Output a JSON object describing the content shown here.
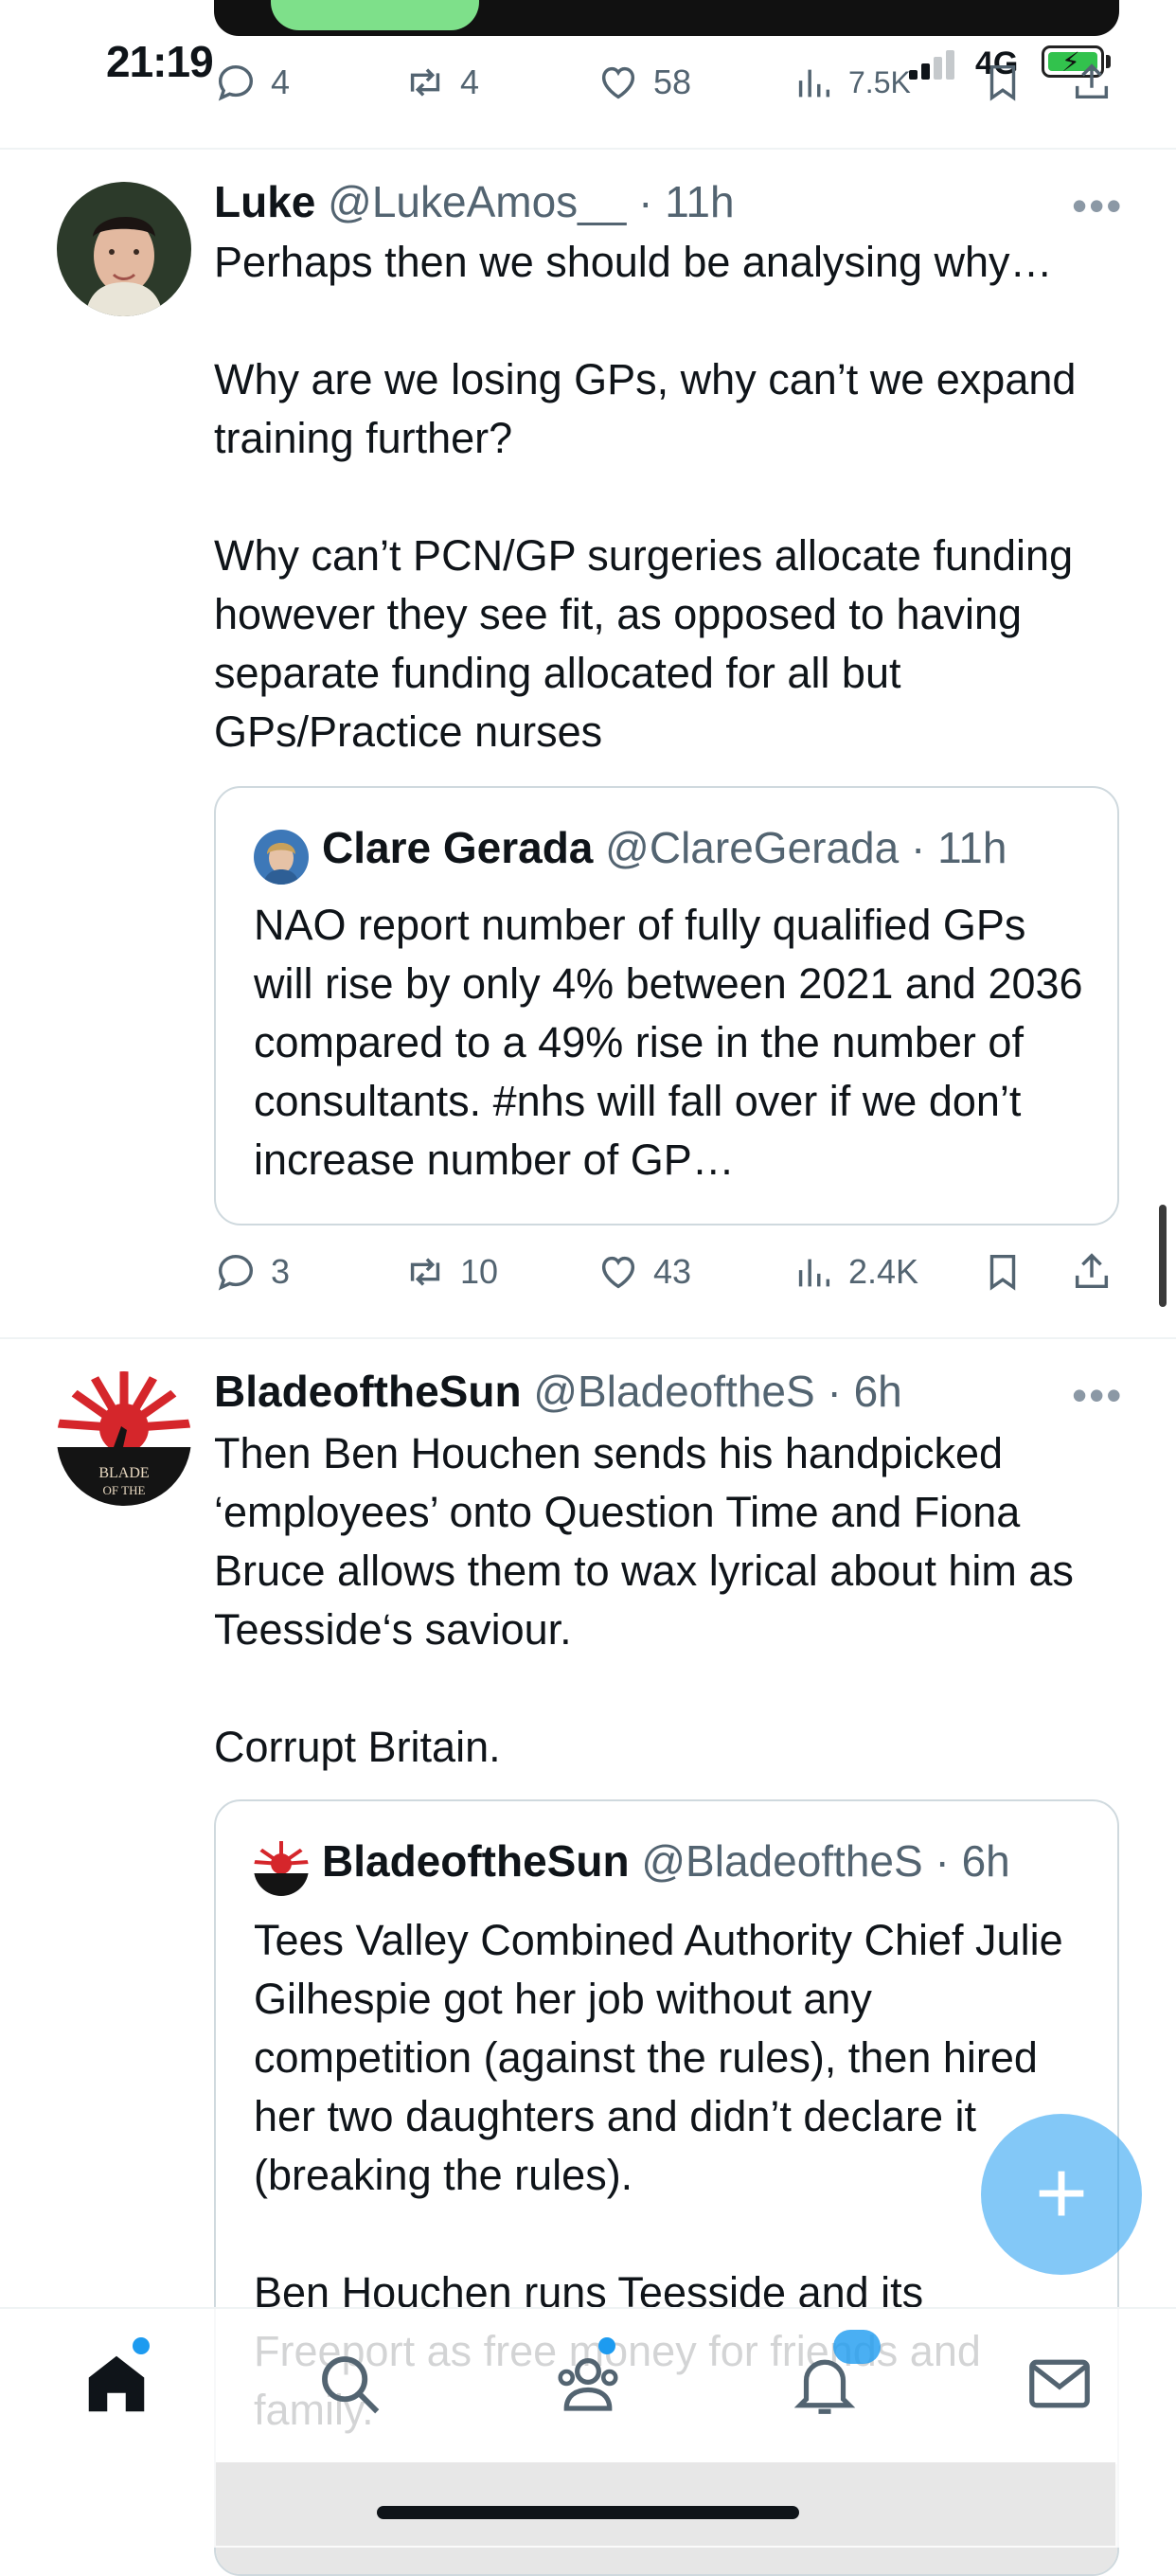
{
  "status_bar": {
    "time": "21:19",
    "network": "4G"
  },
  "prev_tweet_actions": {
    "replies": "4",
    "retweets": "4",
    "likes": "58",
    "views": "7.5K"
  },
  "tweets": [
    {
      "name": "Luke",
      "handle": "@LukeAmos__",
      "time": "· 11h",
      "more": "•••",
      "text": "Perhaps then we should be analysing why…\n\nWhy are we losing GPs, why can’t we expand training further?\n\nWhy can’t PCN/GP surgeries allocate funding however they see fit, as opposed to having separate funding allocated for all but GPs/Practice nurses",
      "quote": {
        "name": "Clare Gerada",
        "handle": "@ClareGerada",
        "time": "· 11h",
        "text": "NAO report number of fully qualified GPs will rise by only 4% between 2021 and 2036 compared to a 49% rise in the number of consultants. #nhs will fall over if we don’t increase number of GP…"
      },
      "actions": {
        "replies": "3",
        "retweets": "10",
        "likes": "43",
        "views": "2.4K"
      }
    },
    {
      "name": "BladeoftheSun",
      "handle": "@BladeoftheS",
      "time": "· 6h",
      "more": "•••",
      "text": "Then Ben Houchen sends his handpicked ‘employees’ onto Question Time and Fiona Bruce allows them to wax lyrical about him as Teesside‘s saviour.\n\nCorrupt Britain.",
      "avatar_text": "BLADE OF THE",
      "quote": {
        "name": "BladeoftheSun",
        "handle": "@BladeoftheS",
        "time": "· 6h",
        "text_1": "Tees Valley Combined Authority Chief Julie Gilhespie got her job without any competition (against the rules), then hired her two daughters and didn’t declare it (breaking the rules).",
        "text_2": "Ben Houchen runs Teesside and its Freeport as free money for friends and family."
      }
    }
  ],
  "fab": {
    "label": "+"
  },
  "colors": {
    "accent": "#1d9bf0",
    "secondary_text": "#536471",
    "border": "#cfd9de"
  }
}
